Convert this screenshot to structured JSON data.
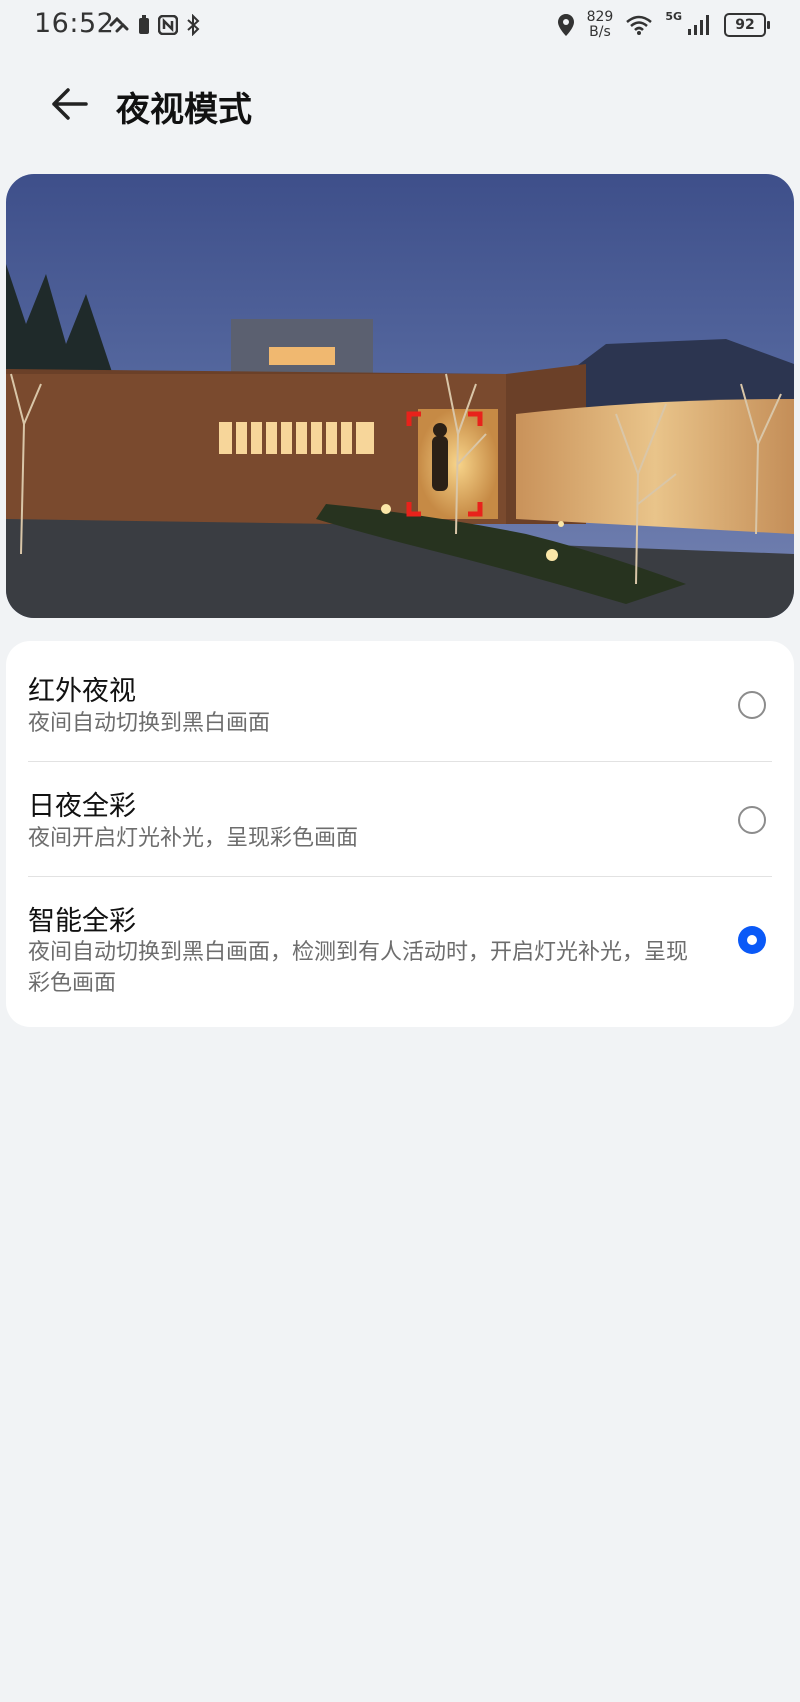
{
  "status_bar": {
    "time": "16:52",
    "net_speed_value": "829",
    "net_speed_unit": "B/s",
    "signal_type": "5G",
    "battery": "92"
  },
  "header": {
    "title": "夜视模式"
  },
  "options": [
    {
      "title": "红外夜视",
      "description": "夜间自动切换到黑白画面",
      "selected": false
    },
    {
      "title": "日夜全彩",
      "description": "夜间开启灯光补光，呈现彩色画面",
      "selected": false
    },
    {
      "title": "智能全彩",
      "description": "夜间自动切换到黑白画面，检测到有人活动时，开启灯光补光，呈现彩色画面",
      "selected": true
    }
  ],
  "colors": {
    "accent": "#0a59f7",
    "background": "#f1f3f5",
    "detection_box": "#e8221b"
  }
}
